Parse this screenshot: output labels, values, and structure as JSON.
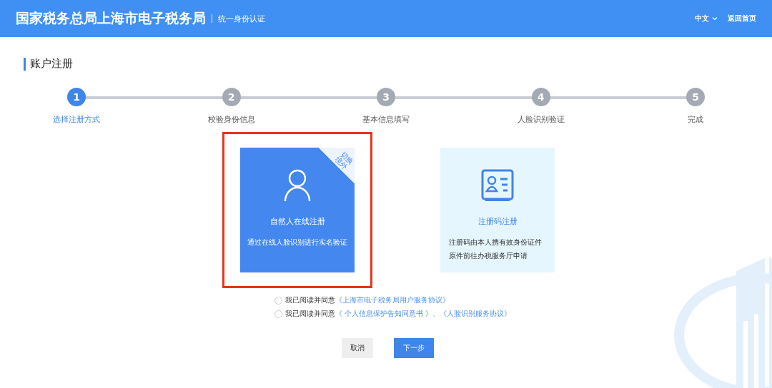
{
  "header": {
    "title": "国家税务总局上海市电子税务局",
    "subtitle": "统一身份认证",
    "language": "中文",
    "home_link": "返回首页"
  },
  "page_title": "账户注册",
  "steps": [
    {
      "number": "1",
      "label": "选择注册方式",
      "selected": true
    },
    {
      "number": "2",
      "label": "校验身份信息",
      "selected": false
    },
    {
      "number": "3",
      "label": "基本信息填写",
      "selected": false
    },
    {
      "number": "4",
      "label": "人脸识别验证",
      "selected": false
    },
    {
      "number": "5",
      "label": "完成",
      "selected": false
    }
  ],
  "options": [
    {
      "kind": "person",
      "title": "自然人在线注册",
      "description": "通过在线人脸识别进行实名验证",
      "corner_badge": "切换境外",
      "selected": true,
      "highlighted": true
    },
    {
      "kind": "id-card",
      "title": "注册码注册",
      "description": "注册码由本人携有效身份证件原件前往办税服务厅申请",
      "selected": false,
      "highlighted": false
    }
  ],
  "agreements": [
    {
      "prefix": "我已阅读并同意",
      "links": [
        "《上海市电子税务局用户服务协议》"
      ],
      "checked": false
    },
    {
      "prefix": "我已阅读并同意",
      "links": [
        "《 个人信息保护告知同意书 》",
        "《人脸识别服务协议》"
      ],
      "separator": "、",
      "checked": false
    }
  ],
  "buttons": [
    {
      "label": "取消",
      "kind": "secondary"
    },
    {
      "label": "下一步",
      "kind": "primary"
    }
  ]
}
